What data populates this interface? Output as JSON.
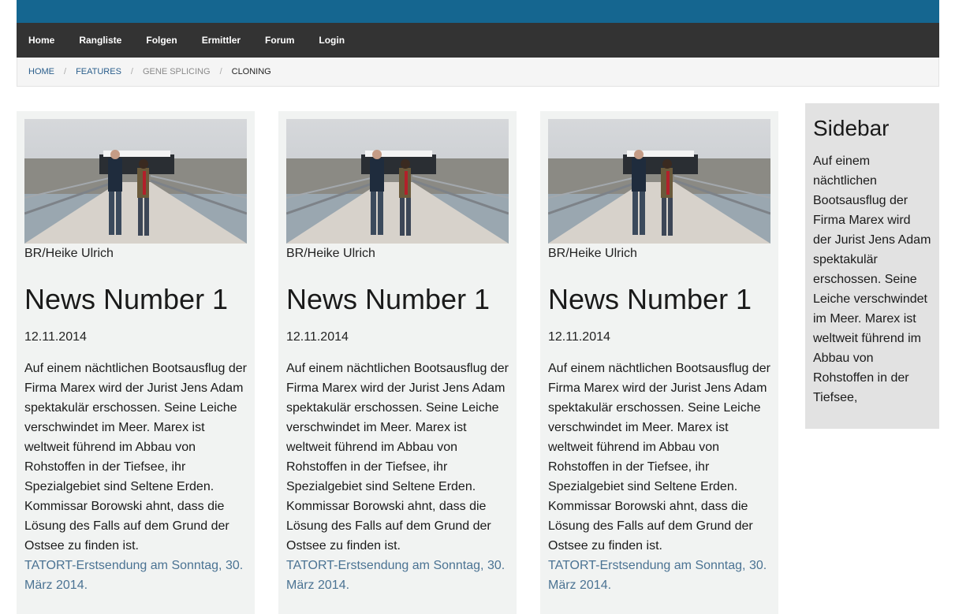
{
  "nav": {
    "items": [
      "Home",
      "Rangliste",
      "Folgen",
      "Ermittler",
      "Forum",
      "Login"
    ]
  },
  "breadcrumb": {
    "home": "HOME",
    "features": "FEATURES",
    "gene_splicing": "GENE SPLICING",
    "current": "CLONING",
    "separator": "/"
  },
  "articles": [
    {
      "credit": "BR/Heike Ulrich",
      "title": "News Number 1",
      "date": "12.11.2014",
      "body": "Auf einem nächtlichen Bootsausflug der Firma Marex wird der Jurist Jens Adam spektakulär erschossen. Seine Leiche verschwindet im Meer. Marex ist weltweit führend im Abbau von Rohstoffen in der Tiefsee, ihr Spezialgebiet sind Seltene Erden. Kommissar Borowski ahnt, dass die Lösung des Falls auf dem Grund der Ostsee zu finden ist.",
      "link": "TATORT-Erstsendung am Sonntag, 30. März 2014."
    },
    {
      "credit": "BR/Heike Ulrich",
      "title": "News Number 1",
      "date": "12.11.2014",
      "body": "Auf einem nächtlichen Bootsausflug der Firma Marex wird der Jurist Jens Adam spektakulär erschossen. Seine Leiche verschwindet im Meer. Marex ist weltweit führend im Abbau von Rohstoffen in der Tiefsee, ihr Spezialgebiet sind Seltene Erden. Kommissar Borowski ahnt, dass die Lösung des Falls auf dem Grund der Ostsee zu finden ist.",
      "link": "TATORT-Erstsendung am Sonntag, 30. März 2014."
    },
    {
      "credit": "BR/Heike Ulrich",
      "title": "News Number 1",
      "date": "12.11.2014",
      "body": "Auf einem nächtlichen Bootsausflug der Firma Marex wird der Jurist Jens Adam spektakulär erschossen. Seine Leiche verschwindet im Meer. Marex ist weltweit führend im Abbau von Rohstoffen in der Tiefsee, ihr Spezialgebiet sind Seltene Erden. Kommissar Borowski ahnt, dass die Lösung des Falls auf dem Grund der Ostsee zu finden ist.",
      "link": "TATORT-Erstsendung am Sonntag, 30. März 2014."
    }
  ],
  "sidebar": {
    "title": "Sidebar",
    "text": "Auf einem nächtlichen Bootsausflug der Firma Marex wird der Jurist Jens Adam spektakulär erschossen. Seine Leiche verschwindet im Meer. Marex ist weltweit führend im Abbau von Rohstoffen in der Tiefsee,"
  },
  "colors": {
    "topbar": "#156690",
    "nav": "#333333",
    "link": "#4b7393",
    "card": "#f1f3f2",
    "sidebar": "#e2e2e2"
  }
}
